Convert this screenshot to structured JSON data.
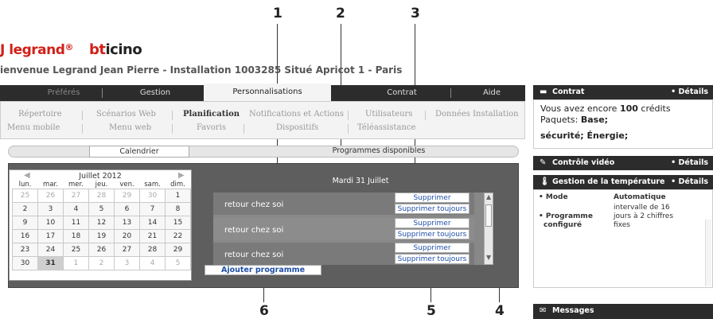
{
  "callouts": [
    "1",
    "2",
    "3",
    "4",
    "5",
    "6"
  ],
  "header": {
    "brand_left": "legrand",
    "brand_left_mark": "®",
    "brand_right_prefix": "bt",
    "brand_right_suffix": "icino",
    "welcome": "ienvenue Legrand Jean Pierre - Installation 1003285 Situé Apricot 1 - Paris"
  },
  "main_nav": {
    "tabs": [
      "Préférés",
      "Gestion",
      "Personnalisations",
      "Contrat",
      "Aide"
    ],
    "active": "Personnalisations"
  },
  "sub_nav": {
    "row1": [
      "Répertoire",
      "Scénarios Web",
      "Planification",
      "Notifications et Actions",
      "Utilisateurs",
      "Données Installation"
    ],
    "row2": [
      "Menu mobile",
      "Menu web",
      "Favoris",
      "Dispositifs",
      "Téléassistance"
    ],
    "active": "Planification"
  },
  "sub_tabs": [
    "Calendrier",
    "Programmes disponibles"
  ],
  "calendar": {
    "month": "Juillet 2012",
    "prev_icon": "chevron-left-icon",
    "next_icon": "chevron-right-icon",
    "weekdays": [
      "lun.",
      "mar.",
      "mer.",
      "jeu.",
      "ven.",
      "sam.",
      "dim."
    ],
    "weeks": [
      [
        "25",
        "26",
        "27",
        "28",
        "29",
        "30",
        "1"
      ],
      [
        "2",
        "3",
        "4",
        "5",
        "6",
        "7",
        "8"
      ],
      [
        "9",
        "10",
        "11",
        "12",
        "13",
        "14",
        "15"
      ],
      [
        "16",
        "17",
        "18",
        "19",
        "20",
        "21",
        "22"
      ],
      [
        "23",
        "24",
        "25",
        "26",
        "27",
        "28",
        "29"
      ],
      [
        "30",
        "31",
        "1",
        "2",
        "3",
        "4",
        "5"
      ]
    ],
    "selected": "31"
  },
  "programs": {
    "day_title": "Mardi 31 Juillet",
    "rows": [
      {
        "name": "retour chez soi",
        "delete": "Supprimer",
        "delete_always": "Supprimer toujours"
      },
      {
        "name": "retour chez soi",
        "delete": "Supprimer",
        "delete_always": "Supprimer toujours"
      },
      {
        "name": "retour chez soi",
        "delete": "Supprimer",
        "delete_always": "Supprimer toujours"
      }
    ],
    "add_button": "Ajouter programme"
  },
  "widgets": {
    "contrat": {
      "title": "Contrat",
      "details": "• Détails",
      "icon": "card-icon",
      "line1_prefix": "Vous avez encore ",
      "line1_credits": "100",
      "line1_suffix": " crédits",
      "line2_prefix": "Paquets: ",
      "line2_value": "Base;",
      "line3": "sécurité; Énergie;"
    },
    "video": {
      "title": "Contrôle vidéo",
      "details": "• Détails",
      "icon": "camera-icon"
    },
    "temperature": {
      "title": "Gestion de la température",
      "details": "• Détails",
      "icon": "thermometer-icon",
      "mode_label": "• Mode",
      "mode_value": "Automatique",
      "program_label_1": "• Programme",
      "program_label_2": "configuré",
      "program_value_1": "intervalle de 16",
      "program_value_2": "jours à 2 chiffres",
      "program_value_3": "fixes"
    },
    "messages": {
      "title": "Messages",
      "icon": "mail-icon"
    }
  },
  "colors": {
    "accent_red": "#d02018",
    "dark_bar": "#2c2c2c",
    "link_blue": "#1f4fa8"
  }
}
